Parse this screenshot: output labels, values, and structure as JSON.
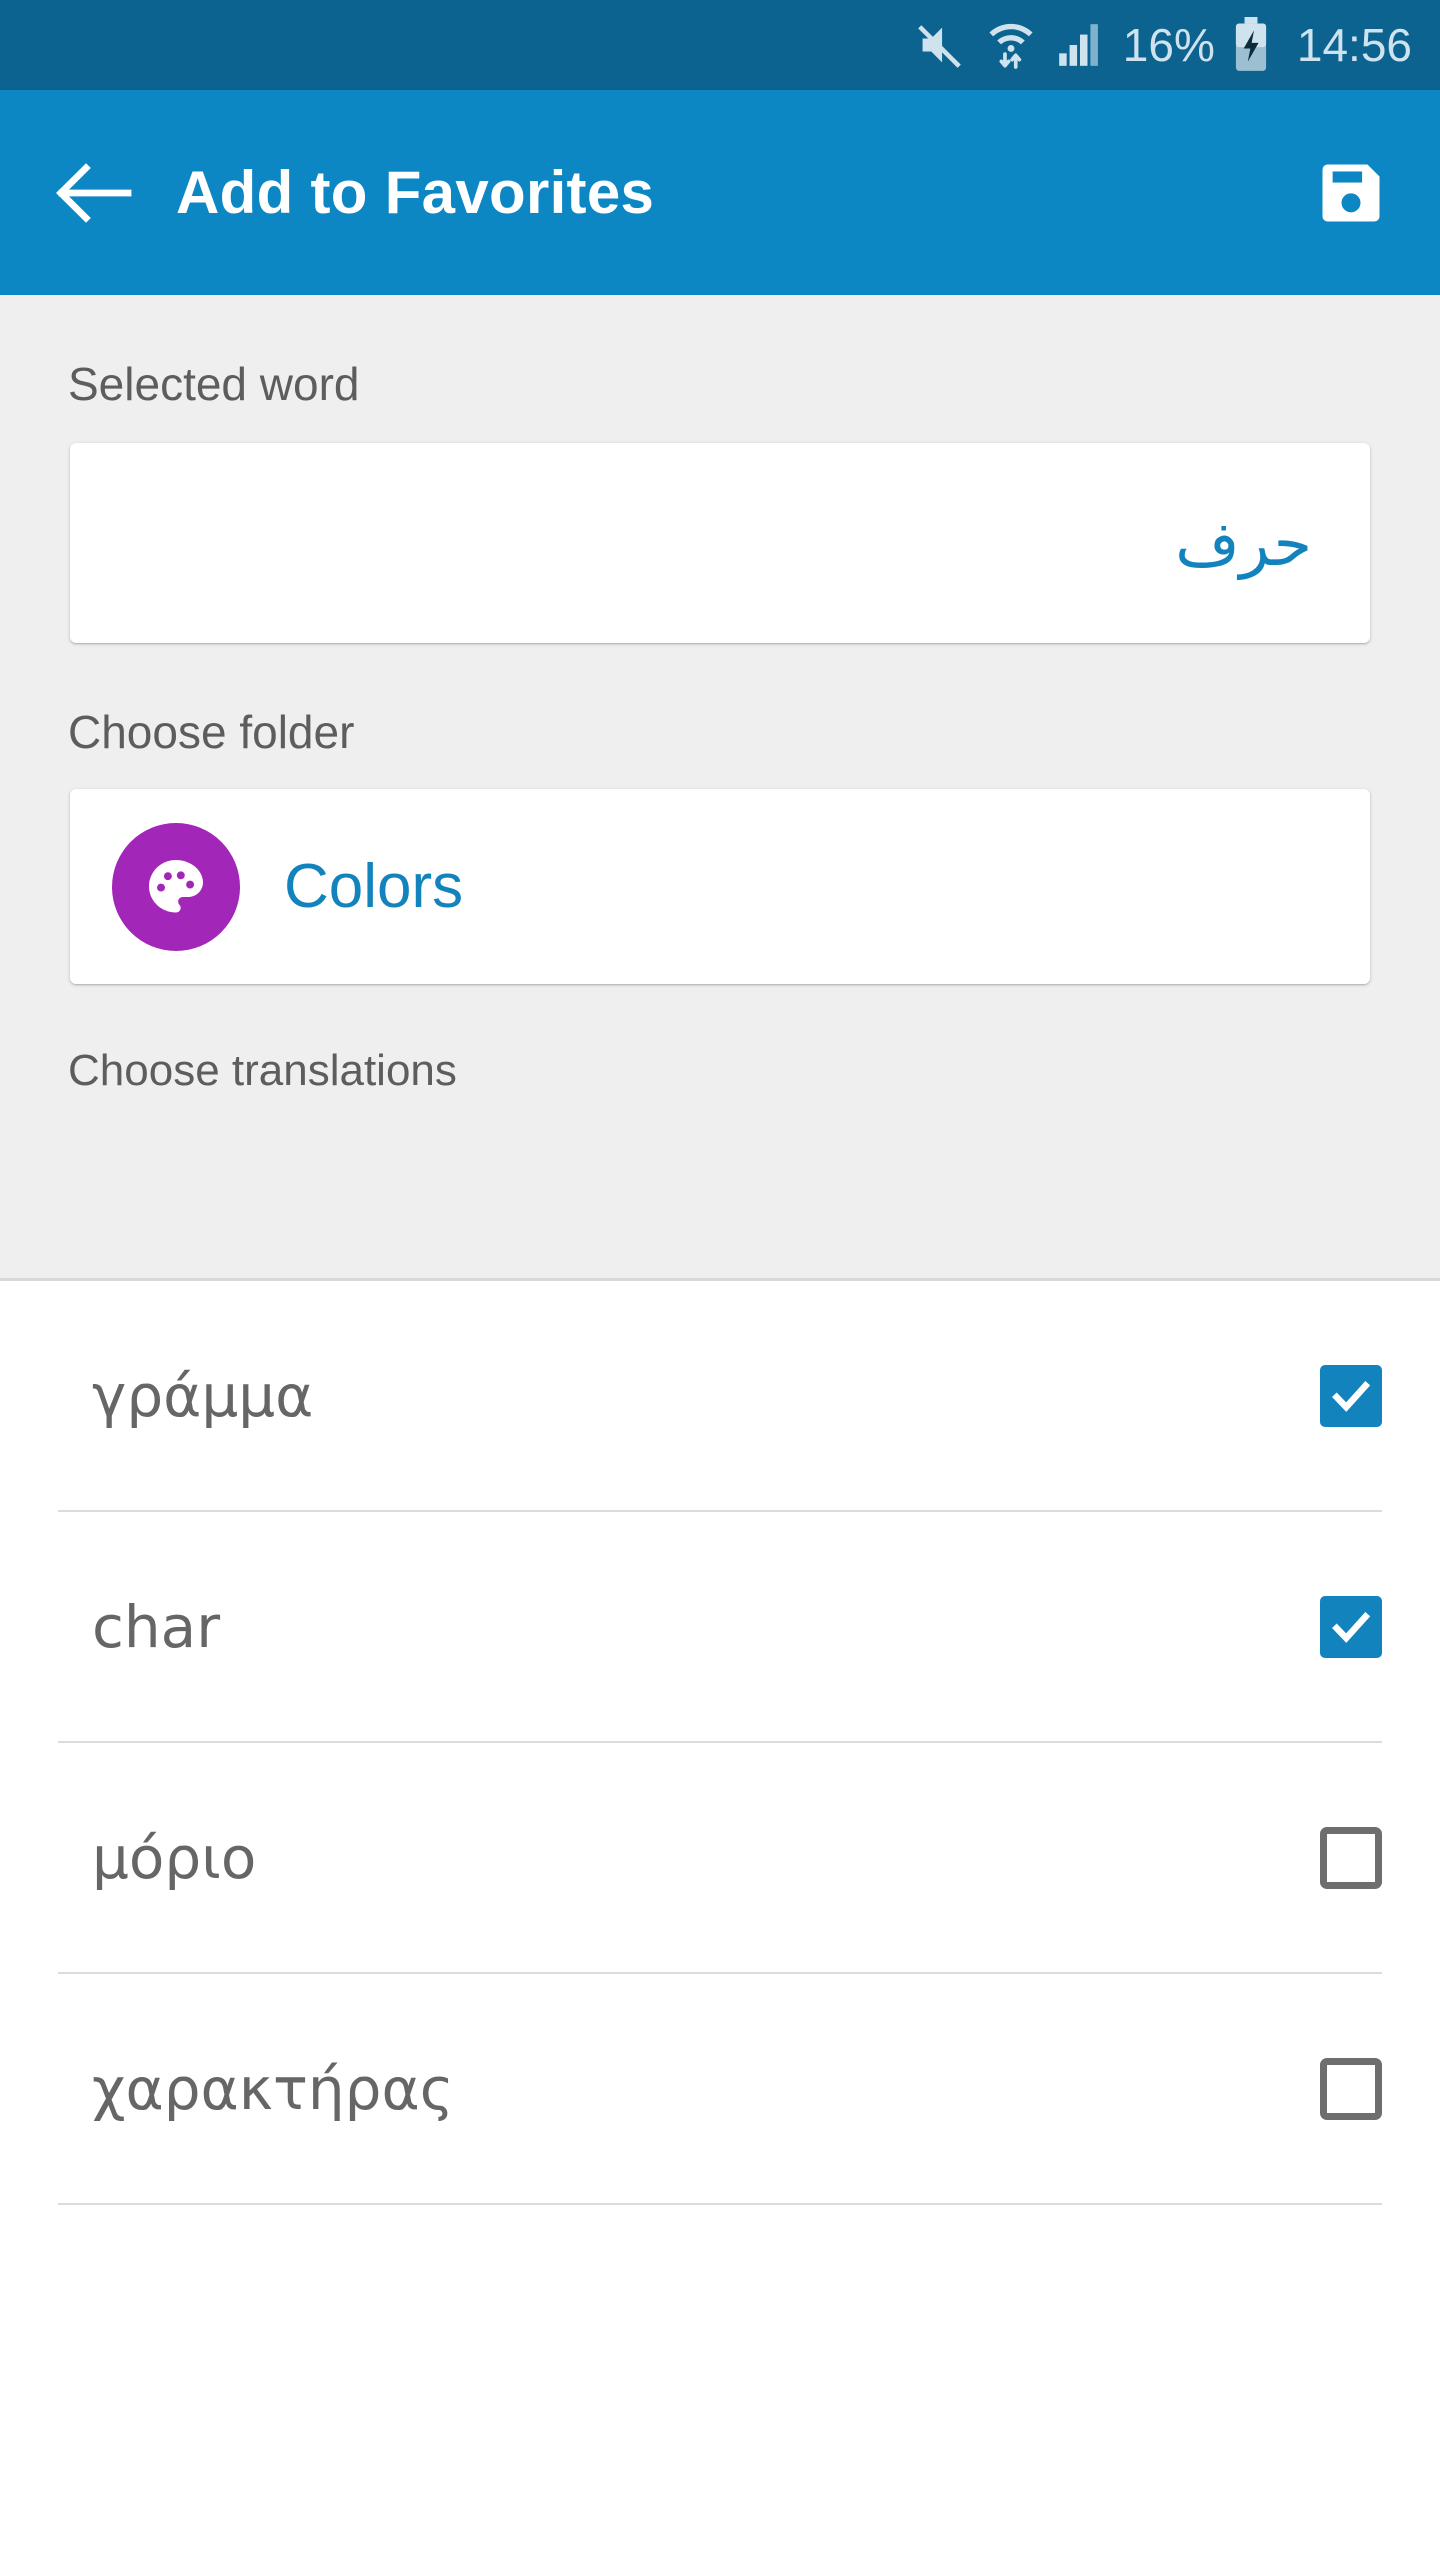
{
  "status_bar": {
    "icons": [
      "mute-icon",
      "wifi-icon",
      "cellular-signal-icon"
    ],
    "battery_percent": "16%",
    "battery_state": "charging",
    "clock": "14:56",
    "background_color": "#0c6390",
    "foreground_color": "#cfe3ef"
  },
  "app_bar": {
    "back_icon": "back-arrow-icon",
    "title": "Add to Favorites",
    "save_icon": "save-floppy-icon",
    "background_color": "#0d87c4"
  },
  "form": {
    "selected_word": {
      "label": "Selected word",
      "value": "حرف",
      "placeholder": "",
      "value_color": "#1383bd"
    },
    "choose_folder": {
      "label": "Choose folder",
      "folder_name": "Colors",
      "folder_icon": "palette-icon",
      "avatar_color": "#a226b7",
      "name_color": "#1383bd"
    },
    "choose_translations": {
      "label": "Choose translations"
    }
  },
  "translations": [
    {
      "text": "γράμμα",
      "checked": true
    },
    {
      "text": "char",
      "checked": true
    },
    {
      "text": "μόριο",
      "checked": false
    },
    {
      "text": "χαρακτήρας",
      "checked": false
    }
  ],
  "colors": {
    "accent": "#1383bd",
    "app_bar": "#0d87c4",
    "status_bar": "#0c6390",
    "folder_purple": "#a226b7",
    "form_background": "#efeff0",
    "text_gray": "#666666",
    "label_gray": "#5d5d5d"
  }
}
